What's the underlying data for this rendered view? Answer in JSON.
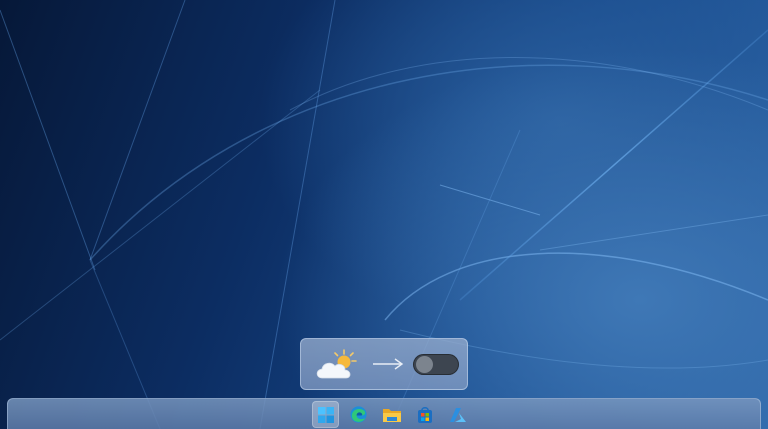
{
  "desktop": {
    "wallpaper": "windows-11-bloom-blue"
  },
  "popup": {
    "weather_icon": "partly-sunny-cloud-icon",
    "arrow_icon": "arrow-right-icon",
    "toggle_state": "off",
    "colors": {
      "toggle_track": "#3d4550",
      "toggle_knob": "#7c848e"
    }
  },
  "taskbar": {
    "icons": [
      {
        "name": "start-windows-icon",
        "active": true
      },
      {
        "name": "edge-browser-icon",
        "active": false
      },
      {
        "name": "file-explorer-icon",
        "active": false
      },
      {
        "name": "microsoft-store-icon",
        "active": false
      },
      {
        "name": "azure-icon",
        "active": false
      }
    ]
  }
}
